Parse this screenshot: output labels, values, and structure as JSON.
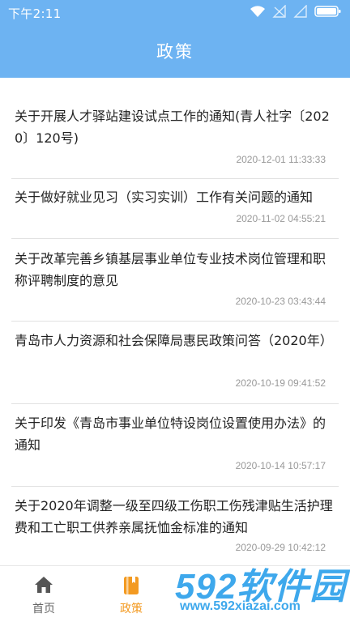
{
  "status_bar": {
    "time": "下午2:11"
  },
  "header": {
    "title": "政策"
  },
  "news": [
    {
      "title": "关于开展人才驿站建设试点工作的通知(青人社字〔2020〕120号)",
      "date": "2020-12-01 11:33:33"
    },
    {
      "title": "关于做好就业见习（实习实训）工作有关问题的通知",
      "date": "2020-11-02 04:55:21"
    },
    {
      "title": "关于改革完善乡镇基层事业单位专业技术岗位管理和职称评聘制度的意见",
      "date": "2020-10-23 03:43:44"
    },
    {
      "title": "青岛市人力资源和社会保障局惠民政策问答（2020年）",
      "date": "2020-10-19 09:41:52"
    },
    {
      "title": "关于印发《青岛市事业单位特设岗位设置使用办法》的通知",
      "date": "2020-10-14 10:57:17"
    },
    {
      "title": "关于2020年调整一级至四级工伤职工伤残津贴生活护理费和工亡职工供养亲属抚恤金标准的通知",
      "date": "2020-09-29 10:42:12"
    }
  ],
  "bottom_nav": {
    "tabs": [
      {
        "label": "首页",
        "icon": "home-icon",
        "active": false
      },
      {
        "label": "政策",
        "icon": "document-icon",
        "active": true
      }
    ]
  },
  "watermark": {
    "logo": "592软件园",
    "url": "www.592xiazai.com"
  },
  "colors": {
    "header_bg": "#6db3f2",
    "active_tab": "#f39a21",
    "watermark": "#3ea8ec"
  }
}
